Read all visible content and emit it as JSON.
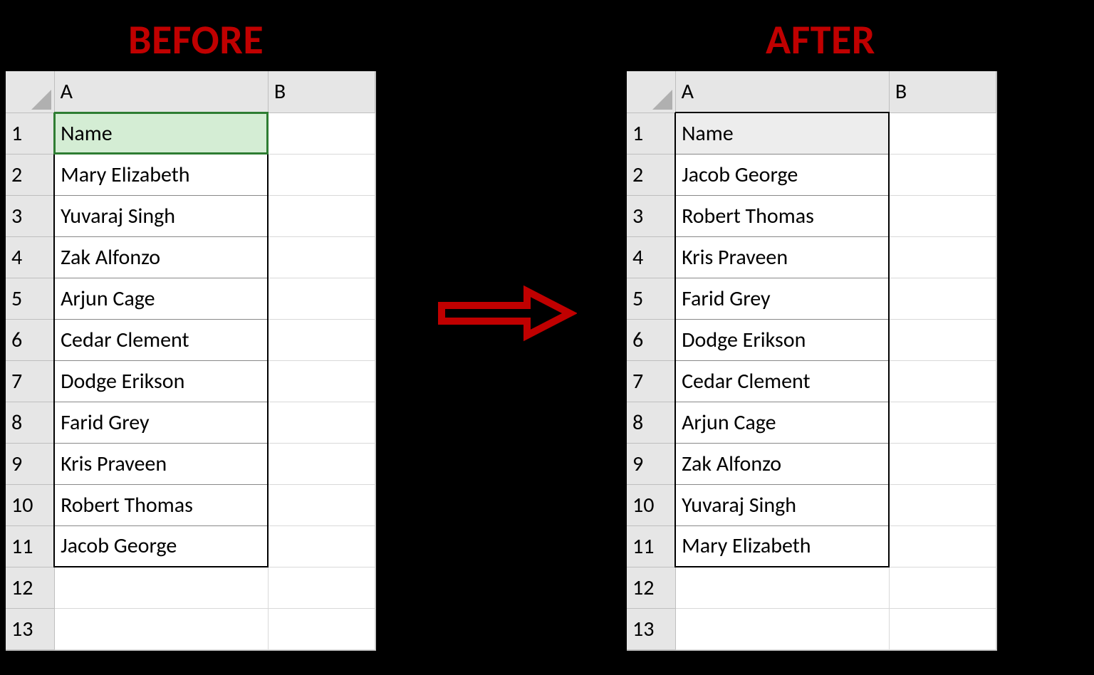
{
  "titles": {
    "before": "BEFORE",
    "after": "AFTER"
  },
  "columns": {
    "A": "A",
    "B": "B"
  },
  "before": {
    "header": "Name",
    "rows": [
      "Mary Elizabeth",
      "Yuvaraj Singh",
      "Zak Alfonzo",
      "Arjun Cage",
      "Cedar Clement",
      "Dodge Erikson",
      "Farid Grey",
      "Kris Praveen",
      "Robert Thomas",
      "Jacob George"
    ],
    "selected_cell": "A1"
  },
  "after": {
    "header": "Name",
    "rows": [
      "Jacob George",
      "Robert Thomas",
      "Kris Praveen",
      "Farid Grey",
      "Dodge Erikson",
      "Cedar Clement",
      "Arjun Cage",
      "Zak Alfonzo",
      "Yuvaraj Singh",
      "Mary Elizabeth"
    ]
  },
  "row_numbers": [
    "1",
    "2",
    "3",
    "4",
    "5",
    "6",
    "7",
    "8",
    "9",
    "10",
    "11",
    "12",
    "13"
  ],
  "arrow_color": "#c00000"
}
